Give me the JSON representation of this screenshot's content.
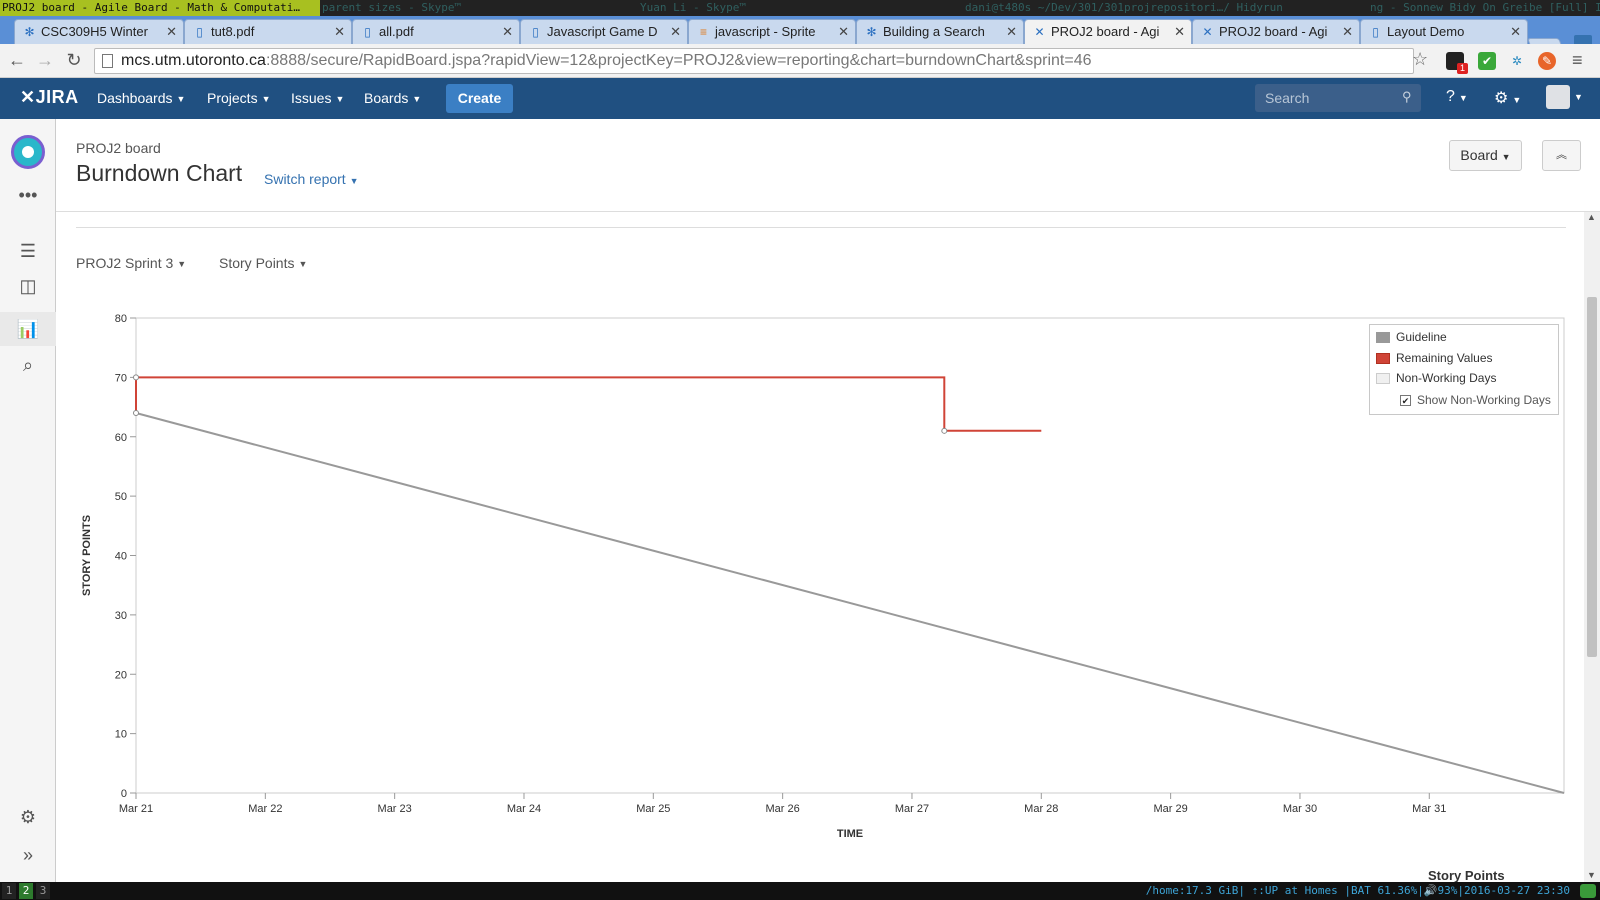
{
  "wm": {
    "active_title": "PROJ2 board - Agile Board - Math & Computati…",
    "segments": [
      {
        "text": "parent sizes - Skype™"
      },
      {
        "text": "Yuan Li - Skype™"
      },
      {
        "text": "dani@t480s ~/Dev/301/301projrepositori…/ Hidyrun"
      },
      {
        "text": "ng - Sonnew Bidy On Greibe [Full] IR"
      }
    ]
  },
  "tabs": [
    {
      "title": "CSC309H5 Winter",
      "icon": "jira-icon"
    },
    {
      "title": "tut8.pdf",
      "icon": "document-icon"
    },
    {
      "title": "all.pdf",
      "icon": "document-icon"
    },
    {
      "title": "Javascript Game D",
      "icon": "document-icon"
    },
    {
      "title": "javascript - Sprite",
      "icon": "stackoverflow-icon"
    },
    {
      "title": "Building a Search",
      "icon": "jira-icon"
    },
    {
      "title": "PROJ2 board - Agi",
      "icon": "jira-agile-icon",
      "active": true
    },
    {
      "title": "PROJ2 board - Agi",
      "icon": "jira-agile-icon"
    },
    {
      "title": "Layout Demo",
      "icon": "document-icon"
    }
  ],
  "address": {
    "host": "mcs.utm.utoronto.ca",
    "rest": ":8888/secure/RapidBoard.jspa?rapidView=12&projectKey=PROJ2&view=reporting&chart=burndownChart&sprint=46"
  },
  "extensions": {
    "badge": "1"
  },
  "header": {
    "logo": "JIRA",
    "nav": [
      "Dashboards",
      "Projects",
      "Issues",
      "Boards"
    ],
    "create": "Create",
    "search_placeholder": "Search"
  },
  "page": {
    "breadcrumb": "PROJ2 board",
    "title": "Burndown Chart",
    "switch_report": "Switch report",
    "board_button": "Board",
    "sprint_select": "PROJ2 Sprint 3",
    "estimate_select": "Story Points",
    "footer_label": "Story Points"
  },
  "colors": {
    "jira_blue": "#205081",
    "create_blue": "#3b7fc4",
    "guideline": "#999999",
    "remaining": "#d04437",
    "non_working": "#f0f0f0"
  },
  "chart_data": {
    "type": "line",
    "xlabel": "TIME",
    "ylabel": "STORY POINTS",
    "ylim": [
      0,
      80
    ],
    "yticks": [
      0,
      10,
      20,
      30,
      40,
      50,
      60,
      70,
      80
    ],
    "xticks": [
      "Mar 21",
      "Mar 22",
      "Mar 23",
      "Mar 24",
      "Mar 25",
      "Mar 26",
      "Mar 27",
      "Mar 28",
      "Mar 29",
      "Mar 30",
      "Mar 31"
    ],
    "xlim": [
      "2016-03-21T00:00",
      "2016-04-01T01:00"
    ],
    "series": [
      {
        "name": "Guideline",
        "color": "#999999",
        "step": false,
        "points": [
          [
            "2016-03-21T00:00",
            64
          ],
          [
            "2016-04-01T01:00",
            0
          ]
        ]
      },
      {
        "name": "Remaining Values",
        "color": "#d04437",
        "step": true,
        "points": [
          [
            "2016-03-21T00:00",
            64
          ],
          [
            "2016-03-21T00:00",
            70
          ],
          [
            "2016-03-27T06:00",
            70
          ],
          [
            "2016-03-27T06:00",
            61
          ],
          [
            "2016-03-28T00:00",
            61
          ]
        ],
        "markers": [
          0,
          1,
          3
        ]
      }
    ],
    "legend": {
      "position": "top-right",
      "items": [
        "Guideline",
        "Remaining Values",
        "Non-Working Days"
      ],
      "checkbox_label": "Show Non-Working Days",
      "checkbox_checked": true
    }
  },
  "status_bar": {
    "workspaces": [
      "1",
      "2",
      "3"
    ],
    "active_workspace": "2",
    "text": "/home:17.3 GiB| ⇡:UP at Homes |BAT 61.36%|🔊93%|2016-03-27 23:30"
  }
}
